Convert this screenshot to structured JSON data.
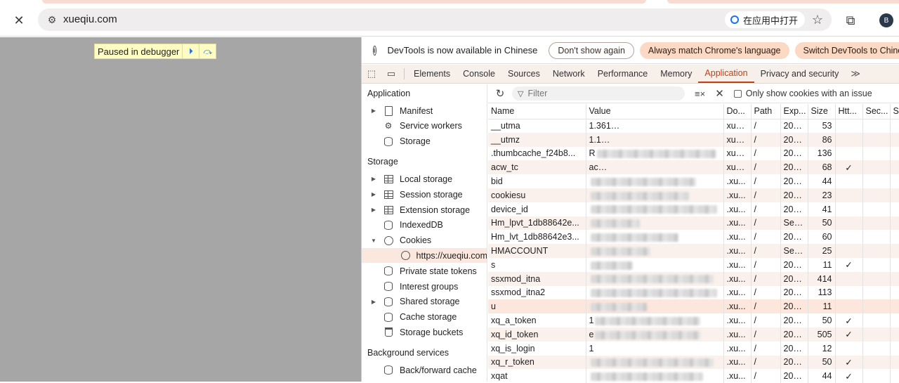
{
  "browser": {
    "url": "xueqiu.com",
    "open_in_app_label": "在应用中打开",
    "close_symbol": "✕",
    "star_symbol": "☆",
    "extensions_symbol": "⧉",
    "avatar_letter": "B"
  },
  "page": {
    "debugger_label": "Paused in debugger",
    "resume_symbol": "⏵",
    "step_over_symbol": "⤼"
  },
  "devtools": {
    "infobar": {
      "info_symbol": "i",
      "message": "DevTools is now available in Chinese",
      "dont_show": "Don't show again",
      "always_match": "Always match Chrome's language",
      "switch_label": "Switch DevTools to Chinese"
    },
    "tabs": [
      "Elements",
      "Console",
      "Sources",
      "Network",
      "Performance",
      "Memory",
      "Application",
      "Privacy and security"
    ],
    "active_tab": "Application",
    "more_tabs_symbol": "≫",
    "sidebar": {
      "application_heading": "Application",
      "application_items": [
        {
          "label": "Manifest",
          "icon": "file-icon",
          "arrow": "▶"
        },
        {
          "label": "Service workers",
          "icon": "gear-icon",
          "arrow": ""
        },
        {
          "label": "Storage",
          "icon": "database-icon",
          "arrow": ""
        }
      ],
      "storage_heading": "Storage",
      "storage_items": [
        {
          "label": "Local storage",
          "icon": "grid-icon",
          "arrow": "▶"
        },
        {
          "label": "Session storage",
          "icon": "grid-icon",
          "arrow": "▶"
        },
        {
          "label": "Extension storage",
          "icon": "grid-icon",
          "arrow": "▶"
        },
        {
          "label": "IndexedDB",
          "icon": "database-icon",
          "arrow": ""
        },
        {
          "label": "Cookies",
          "icon": "cookie-icon",
          "arrow": "▼"
        },
        {
          "label": "https://xueqiu.com",
          "icon": "cookie-icon",
          "arrow": "",
          "child": true,
          "selected": true
        },
        {
          "label": "Private state tokens",
          "icon": "database-icon",
          "arrow": ""
        },
        {
          "label": "Interest groups",
          "icon": "database-icon",
          "arrow": ""
        },
        {
          "label": "Shared storage",
          "icon": "database-icon",
          "arrow": "▶"
        },
        {
          "label": "Cache storage",
          "icon": "database-icon",
          "arrow": ""
        },
        {
          "label": "Storage buckets",
          "icon": "bucket-icon",
          "arrow": ""
        }
      ],
      "background_heading": "Background services",
      "background_items": [
        {
          "label": "Back/forward cache",
          "icon": "database-icon",
          "arrow": ""
        }
      ]
    },
    "cookies": {
      "refresh_symbol": "↻",
      "filter_placeholder": "Filter",
      "clear_symbol": "≡×",
      "delete_symbol": "✕",
      "only_issues_label": "Only show cookies with an issue",
      "columns": [
        "Name",
        "Value",
        "Do...",
        "Path",
        "Exp...",
        "Size",
        "Htt...",
        "Sec...",
        "S"
      ],
      "rows": [
        {
          "name": "__utma",
          "value": "1.361",
          "domain": "xue...",
          "path": "/",
          "expires": "202...",
          "size": "53",
          "http": "",
          "secure": ""
        },
        {
          "name": "__utmz",
          "value": "1.1",
          "domain": "xue...",
          "path": "/",
          "expires": "202...",
          "size": "86",
          "http": "",
          "secure": ""
        },
        {
          "name": ".thumbcache_f24b8...",
          "value": "R",
          "domain": "xue...",
          "path": "/",
          "expires": "202...",
          "size": "136",
          "http": "",
          "secure": ""
        },
        {
          "name": "acw_tc",
          "value": "ac",
          "domain": "xue...",
          "path": "/",
          "expires": "202...",
          "size": "68",
          "http": "✓",
          "secure": ""
        },
        {
          "name": "bid",
          "value": "",
          "domain": ".xu...",
          "path": "/",
          "expires": "202...",
          "size": "44",
          "http": "",
          "secure": ""
        },
        {
          "name": "cookiesu",
          "value": "",
          "domain": ".xu...",
          "path": "/",
          "expires": "202...",
          "size": "23",
          "http": "",
          "secure": ""
        },
        {
          "name": "device_id",
          "value": "",
          "domain": ".xu...",
          "path": "/",
          "expires": "202...",
          "size": "41",
          "http": "",
          "secure": ""
        },
        {
          "name": "Hm_lpvt_1db88642e...",
          "value": "",
          "domain": ".xu...",
          "path": "/",
          "expires": "Ses...",
          "size": "50",
          "http": "",
          "secure": ""
        },
        {
          "name": "Hm_lvt_1db88642e3...",
          "value": "",
          "domain": ".xu...",
          "path": "/",
          "expires": "202...",
          "size": "60",
          "http": "",
          "secure": ""
        },
        {
          "name": "HMACCOUNT",
          "value": "",
          "domain": ".xu...",
          "path": "/",
          "expires": "Ses...",
          "size": "25",
          "http": "",
          "secure": ""
        },
        {
          "name": "s",
          "value": "",
          "domain": ".xu...",
          "path": "/",
          "expires": "202...",
          "size": "11",
          "http": "✓",
          "secure": ""
        },
        {
          "name": "ssxmod_itna",
          "value": "",
          "domain": ".xu...",
          "path": "/",
          "expires": "202...",
          "size": "414",
          "http": "",
          "secure": ""
        },
        {
          "name": "ssxmod_itna2",
          "value": "",
          "domain": ".xu...",
          "path": "/",
          "expires": "202...",
          "size": "113",
          "http": "",
          "secure": ""
        },
        {
          "name": "u",
          "value": "",
          "domain": ".xu...",
          "path": "/",
          "expires": "202...",
          "size": "11",
          "http": "",
          "secure": "",
          "highlight": true
        },
        {
          "name": "xq_a_token",
          "value": "1",
          "domain": ".xu...",
          "path": "/",
          "expires": "202...",
          "size": "50",
          "http": "✓",
          "secure": ""
        },
        {
          "name": "xq_id_token",
          "value": "e",
          "domain": ".xu...",
          "path": "/",
          "expires": "202...",
          "size": "505",
          "http": "✓",
          "secure": ""
        },
        {
          "name": "xq_is_login",
          "value": "1",
          "domain": ".xu...",
          "path": "/",
          "expires": "202...",
          "size": "12",
          "http": "",
          "secure": ""
        },
        {
          "name": "xq_r_token",
          "value": "",
          "domain": ".xu...",
          "path": "/",
          "expires": "202...",
          "size": "50",
          "http": "✓",
          "secure": ""
        },
        {
          "name": "xqat",
          "value": "",
          "domain": ".xu...",
          "path": "/",
          "expires": "202...",
          "size": "44",
          "http": "✓",
          "secure": ""
        }
      ]
    }
  },
  "colors": {
    "accent": "#b5461b",
    "selected_row": "#fae8df",
    "info_button_fill": "#fbd9c4",
    "page_background": "#a6a6a6"
  }
}
